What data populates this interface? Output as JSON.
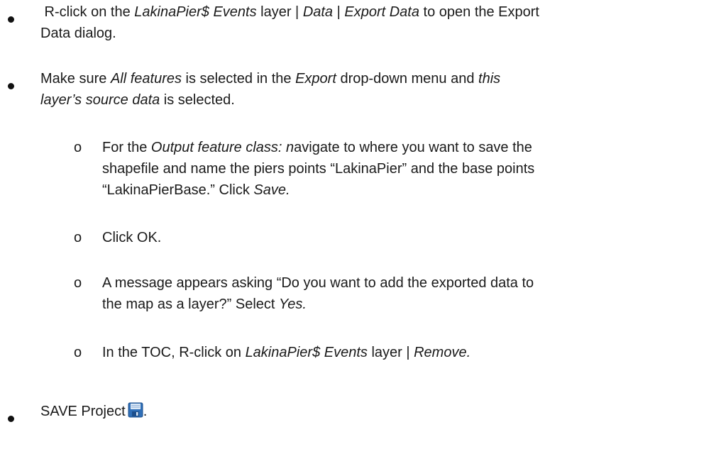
{
  "bullets": {
    "b1": {
      "line1_pre": " R-click on the ",
      "line1_italic1": "LakinaPier$ Events",
      "line1_mid1": " layer | ",
      "line1_italic2": "Data",
      "line1_mid2": " | ",
      "line1_italic3": "Export Data",
      "line1_post": " to open the Export",
      "line2": "Data dialog."
    },
    "b2": {
      "line1_pre": "Make sure ",
      "line1_italic1": "All features",
      "line1_mid1": " is selected in the ",
      "line1_italic2": "Export",
      "line1_mid2": " drop-down menu and ",
      "line1_italic3": "this",
      "line2_italic": "layer’s source data",
      "line2_post": " is selected."
    },
    "b3": {
      "text": "SAVE Project",
      "post": ".",
      "icon": "floppy-disk-save-icon"
    }
  },
  "sub_marker": "o",
  "subs": {
    "s1": {
      "line1_pre": "For the ",
      "line1_italic": "Output feature class: n",
      "line1_post": "avigate to where you want to save the",
      "line2": "shapefile and name the piers points “LakinaPier” and the base points",
      "line3_pre": "“LakinaPierBase.” Click ",
      "line3_italic": "Save."
    },
    "s2": {
      "text": "Click OK."
    },
    "s3": {
      "line1": "A message appears asking “Do you want to add the exported data to",
      "line2_pre": "the map as a layer?” Select ",
      "line2_italic": "Yes."
    },
    "s4": {
      "pre": "In the TOC, R-click on ",
      "italic1": "LakinaPier$ Events",
      "mid": " layer | ",
      "italic2": "Remove."
    }
  },
  "colors": {
    "text": "#1a1a1a",
    "icon_blue": "#2f6fb8",
    "icon_light": "#dbe8f6"
  }
}
